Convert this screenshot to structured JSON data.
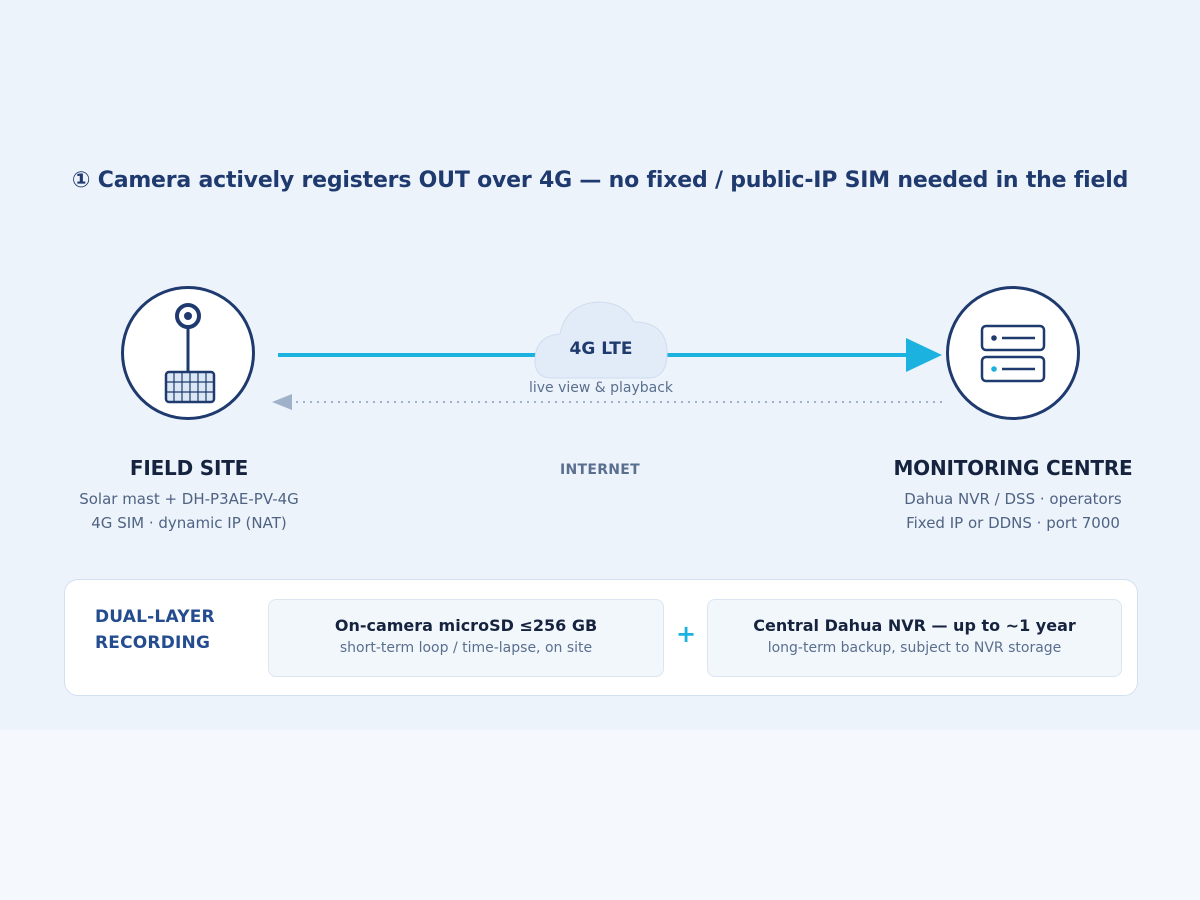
{
  "headline": "① Camera actively registers OUT over 4G — no fixed / public-IP SIM needed in the field",
  "colors": {
    "navy": "#1f3a6e",
    "accent": "#1bb2e0",
    "muted": "#5a6f8e",
    "panel": "#edf3fb"
  },
  "flow": {
    "link_label": "4G LTE",
    "return_label": "live view & playback",
    "network_label": "INTERNET"
  },
  "field_site": {
    "icon": "solar-camera-mast-icon",
    "title": "FIELD SITE",
    "lines": [
      "Solar mast + DH-P3AE-PV-4G",
      "4G SIM · dynamic IP (NAT)"
    ]
  },
  "monitoring_centre": {
    "icon": "server-rack-icon",
    "title": "MONITORING CENTRE",
    "lines": [
      "Dahua NVR / DSS · operators",
      "Fixed IP or DDNS · port 7000"
    ]
  },
  "recording": {
    "heading_lines": [
      "DUAL-LAYER",
      "RECORDING"
    ],
    "plus": "+",
    "items": [
      {
        "title": "On-camera microSD ≤256 GB",
        "subtitle": "short-term loop / time-lapse, on site"
      },
      {
        "title": "Central Dahua NVR — up to ~1 year",
        "subtitle": "long-term backup, subject to NVR storage"
      }
    ]
  }
}
